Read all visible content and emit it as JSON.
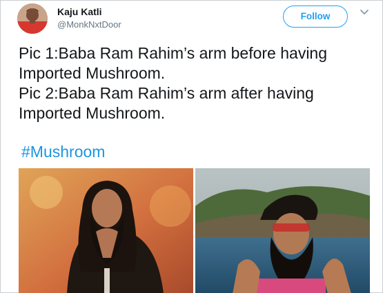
{
  "tweet": {
    "user": {
      "name": "Kaju Katli",
      "handle": "@MonkNxtDoor"
    },
    "follow_label": "Follow",
    "text_lines": [
      "Pic 1:Baba Ram Rahim’s arm before having",
      "Imported Mushroom.",
      "Pic 2:Baba Ram Rahim’s arm after having",
      "Imported Mushroom."
    ],
    "hashtag": "#Mushroom"
  },
  "colors": {
    "brand_blue": "#1da1f2",
    "hashtag_blue": "#1b95e0",
    "secondary_text": "#657786"
  },
  "icons": {
    "menu": "chevron-down-icon"
  }
}
